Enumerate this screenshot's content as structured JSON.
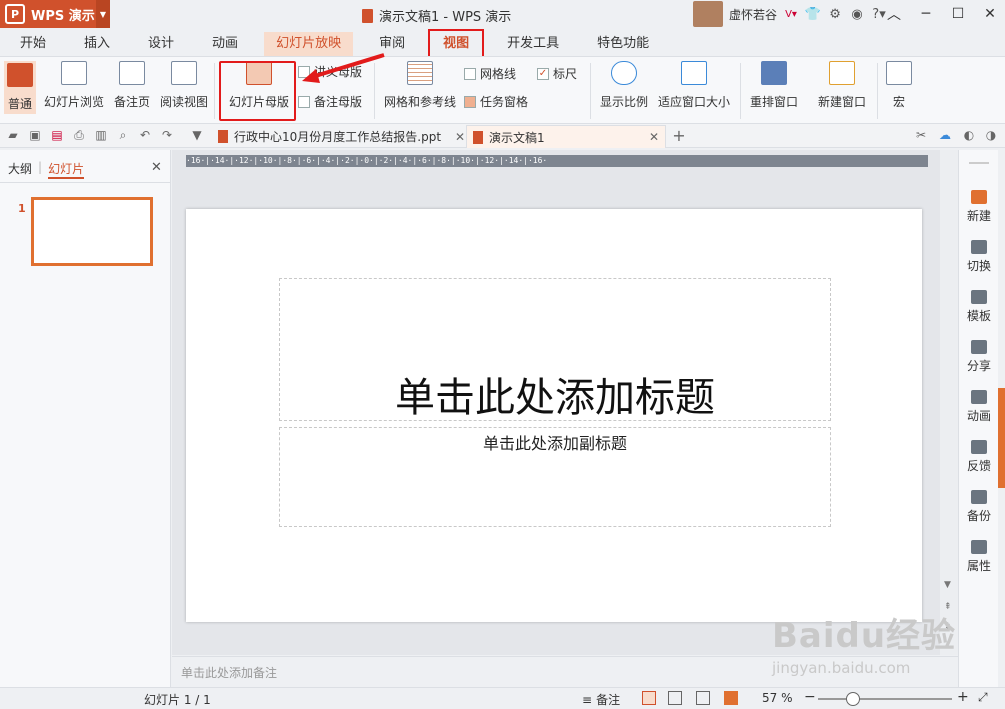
{
  "app": {
    "logo": "P",
    "name": "WPS 演示"
  },
  "window": {
    "title": "演示文稿1 - WPS 演示",
    "user": "虚怀若谷"
  },
  "menu": [
    "开始",
    "插入",
    "设计",
    "动画",
    "幻灯片放映",
    "审阅",
    "视图",
    "开发工具",
    "特色功能"
  ],
  "ribbon": {
    "normal": "普通",
    "sorter": "幻灯片浏览",
    "notes_page": "备注页",
    "reading": "阅读视图",
    "slide_master": "幻灯片母版",
    "handout_master": "讲义母版",
    "notes_master": "备注母版",
    "grid": "网格和参考线",
    "gridlines": "网格线",
    "ruler": "标尺",
    "task_pane": "任务窗格",
    "zoom": "显示比例",
    "fit_window": "适应窗口大小",
    "arrange": "重排窗口",
    "new_window": "新建窗口",
    "macro": "宏"
  },
  "tabs": {
    "file1": "行政中心10月份月度工作总结报告.ppt",
    "file2": "演示文稿1",
    "add": "+"
  },
  "left_panel": {
    "outline": "大纲",
    "slides": "幻灯片",
    "slide_num": "1"
  },
  "ruler_text": "·16·|·14·|·12·|·10·|·8·|·6·|·4·|·2·|·0·|·2·|·4·|·6·|·8·|·10·|·12·|·14·|·16·",
  "slide": {
    "title": "单击此处添加标题",
    "subtitle": "单击此处添加副标题"
  },
  "notes_placeholder": "单击此处添加备注",
  "right_sidebar": [
    "新建",
    "切换",
    "模板",
    "分享",
    "动画",
    "反馈",
    "备份",
    "属性"
  ],
  "status": {
    "slide": "幻灯片 1 / 1",
    "notes": "备注",
    "zoom": "57 %"
  },
  "watermark": {
    "logo": "Baidu经验",
    "url": "jingyan.baidu.com"
  },
  "colors": {
    "accent": "#d0512c",
    "highlight": "#e21b1b"
  }
}
